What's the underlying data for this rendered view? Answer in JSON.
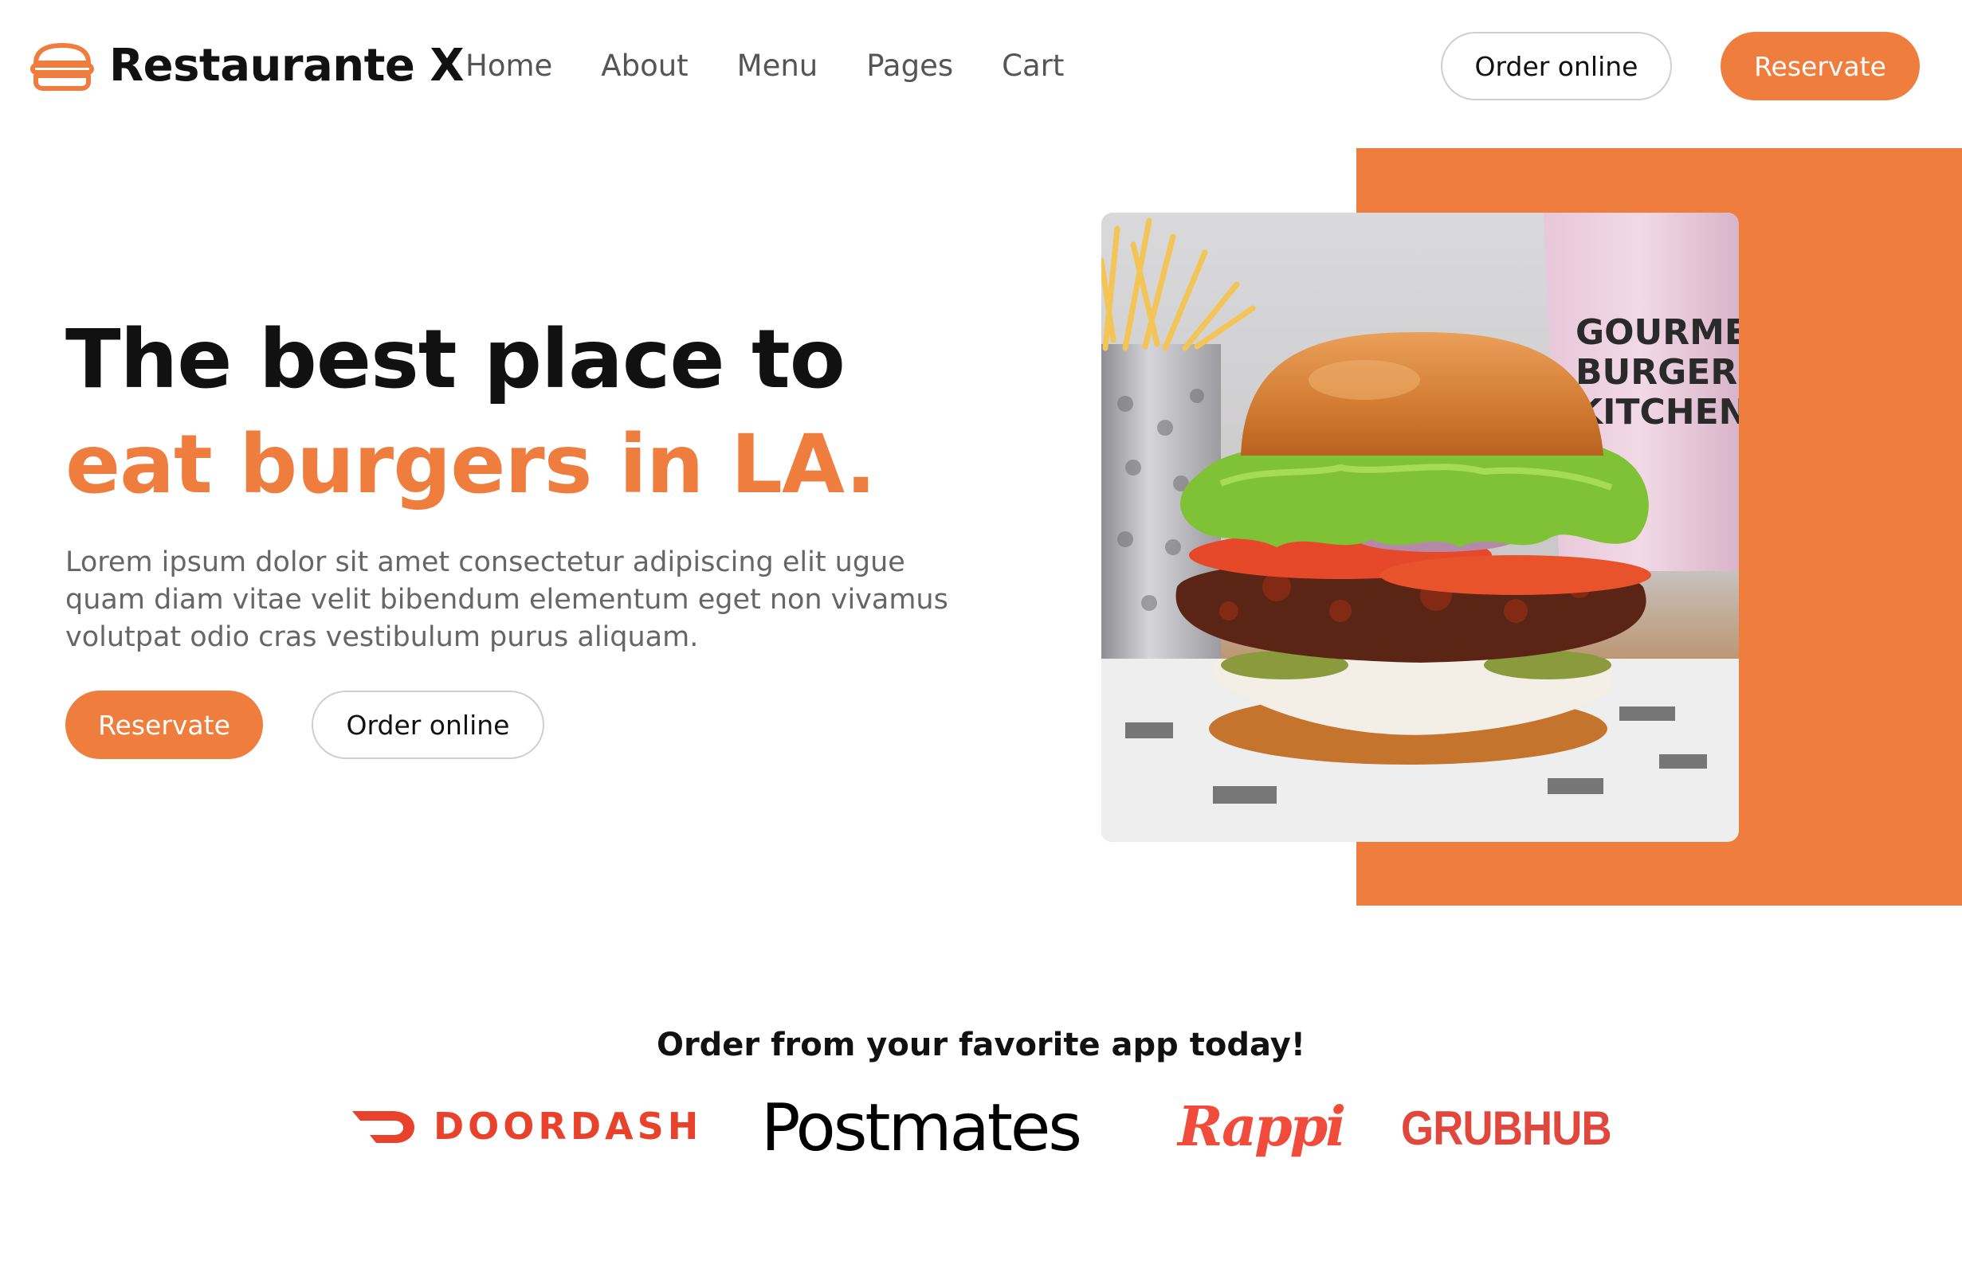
{
  "header": {
    "brand": "Restaurante X",
    "nav": [
      "Home",
      "About",
      "Menu",
      "Pages",
      "Cart"
    ],
    "order_online_label": "Order online",
    "reservate_label": "Reservate"
  },
  "hero": {
    "title_line1": "The best place to",
    "title_line2": "eat burgers in LA.",
    "description": "Lorem ipsum dolor sit amet consectetur adipiscing elit ugue quam diam vitae velit bibendum elementum eget non vivamus volutpat odio cras vestibulum purus aliquam.",
    "reservate_label": "Reservate",
    "order_online_label": "Order online",
    "image_alt": "burger-photo",
    "cup_text": [
      "GOURMET",
      "BURGER",
      "KITCHEN"
    ]
  },
  "apps": {
    "title": "Order from your favorite app today!",
    "logos": [
      "DOORDASH",
      "Postmates",
      "Rappi",
      "GRUBHUB"
    ]
  },
  "colors": {
    "accent": "#ef7d3e",
    "doordash": "#e8412c",
    "rappi": "#f04b3b",
    "grubhub": "#e0473d"
  }
}
